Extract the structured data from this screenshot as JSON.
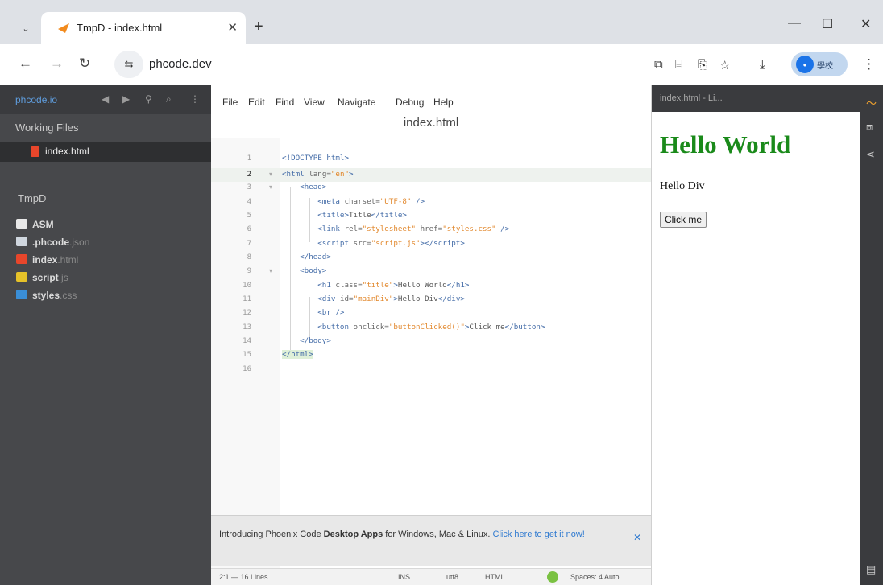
{
  "browser": {
    "tab_title": "TmpD - index.html",
    "url": "phcode.dev",
    "profile_label": "學校"
  },
  "app": {
    "sidebar": {
      "brand": "phcode.io",
      "working_files_label": "Working Files",
      "working_file": "index.html",
      "project_label": "TmpD",
      "tree": [
        {
          "name": "ASM",
          "ext": "",
          "color": "#e8e8e8"
        },
        {
          "name": ".phcode",
          "ext": ".json",
          "color": "#cfd6de"
        },
        {
          "name": "index",
          "ext": ".html",
          "color": "#e8462b"
        },
        {
          "name": "script",
          "ext": ".js",
          "color": "#e6c229"
        },
        {
          "name": "styles",
          "ext": ".css",
          "color": "#3a8ed6"
        }
      ]
    },
    "menu": {
      "file": "File",
      "edit": "Edit",
      "find": "Find",
      "view": "View",
      "navigate": "Navigate",
      "debug": "Debug",
      "help": "Help"
    },
    "doc_title": "index.html",
    "banner": {
      "intro": "Introducing Phoenix Code ",
      "bold": "Desktop Apps",
      "rest": " for Windows, Mac & Linux. ",
      "link": "Click here to get it now!"
    },
    "status": {
      "cursor": "2:1 — 16 Lines",
      "ins": "INS",
      "encoding": "utf8",
      "language": "HTML",
      "spaces": "Spaces: 4 Auto"
    },
    "preview": {
      "header": "index.html - Li...",
      "h1": "Hello World",
      "div_text": "Hello Div",
      "button_label": "Click me"
    }
  }
}
